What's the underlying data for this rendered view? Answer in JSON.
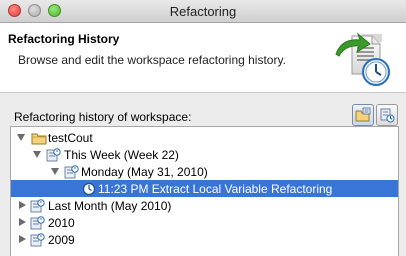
{
  "window": {
    "title": "Refactoring"
  },
  "header": {
    "title": "Refactoring History",
    "description": "Browse and edit the workspace refactoring history."
  },
  "history": {
    "label": "Refactoring history of workspace:",
    "toolbar": [
      {
        "icon": "sort-by-project-icon",
        "pressed": true
      },
      {
        "icon": "sort-by-date-icon",
        "pressed": false
      }
    ],
    "tree": [
      {
        "label": "testCout",
        "icon": "project-folder-icon",
        "expanded": true
      },
      {
        "label": "This Week (Week 22)",
        "icon": "history-icon",
        "expanded": true
      },
      {
        "label": "Monday (May 31, 2010)",
        "icon": "history-icon",
        "expanded": true
      },
      {
        "label": "11:23 PM Extract Local Variable Refactoring",
        "icon": "clock-icon",
        "selected": true
      },
      {
        "label": "Last Month (May 2010)",
        "icon": "history-icon",
        "expanded": false
      },
      {
        "label": "2010",
        "icon": "history-icon",
        "expanded": false
      },
      {
        "label": "2009",
        "icon": "history-icon",
        "expanded": false
      }
    ]
  },
  "colors": {
    "selection": "#3875d7",
    "accent_green": "#3a9a2a",
    "clock_blue": "#2b6fb8"
  }
}
